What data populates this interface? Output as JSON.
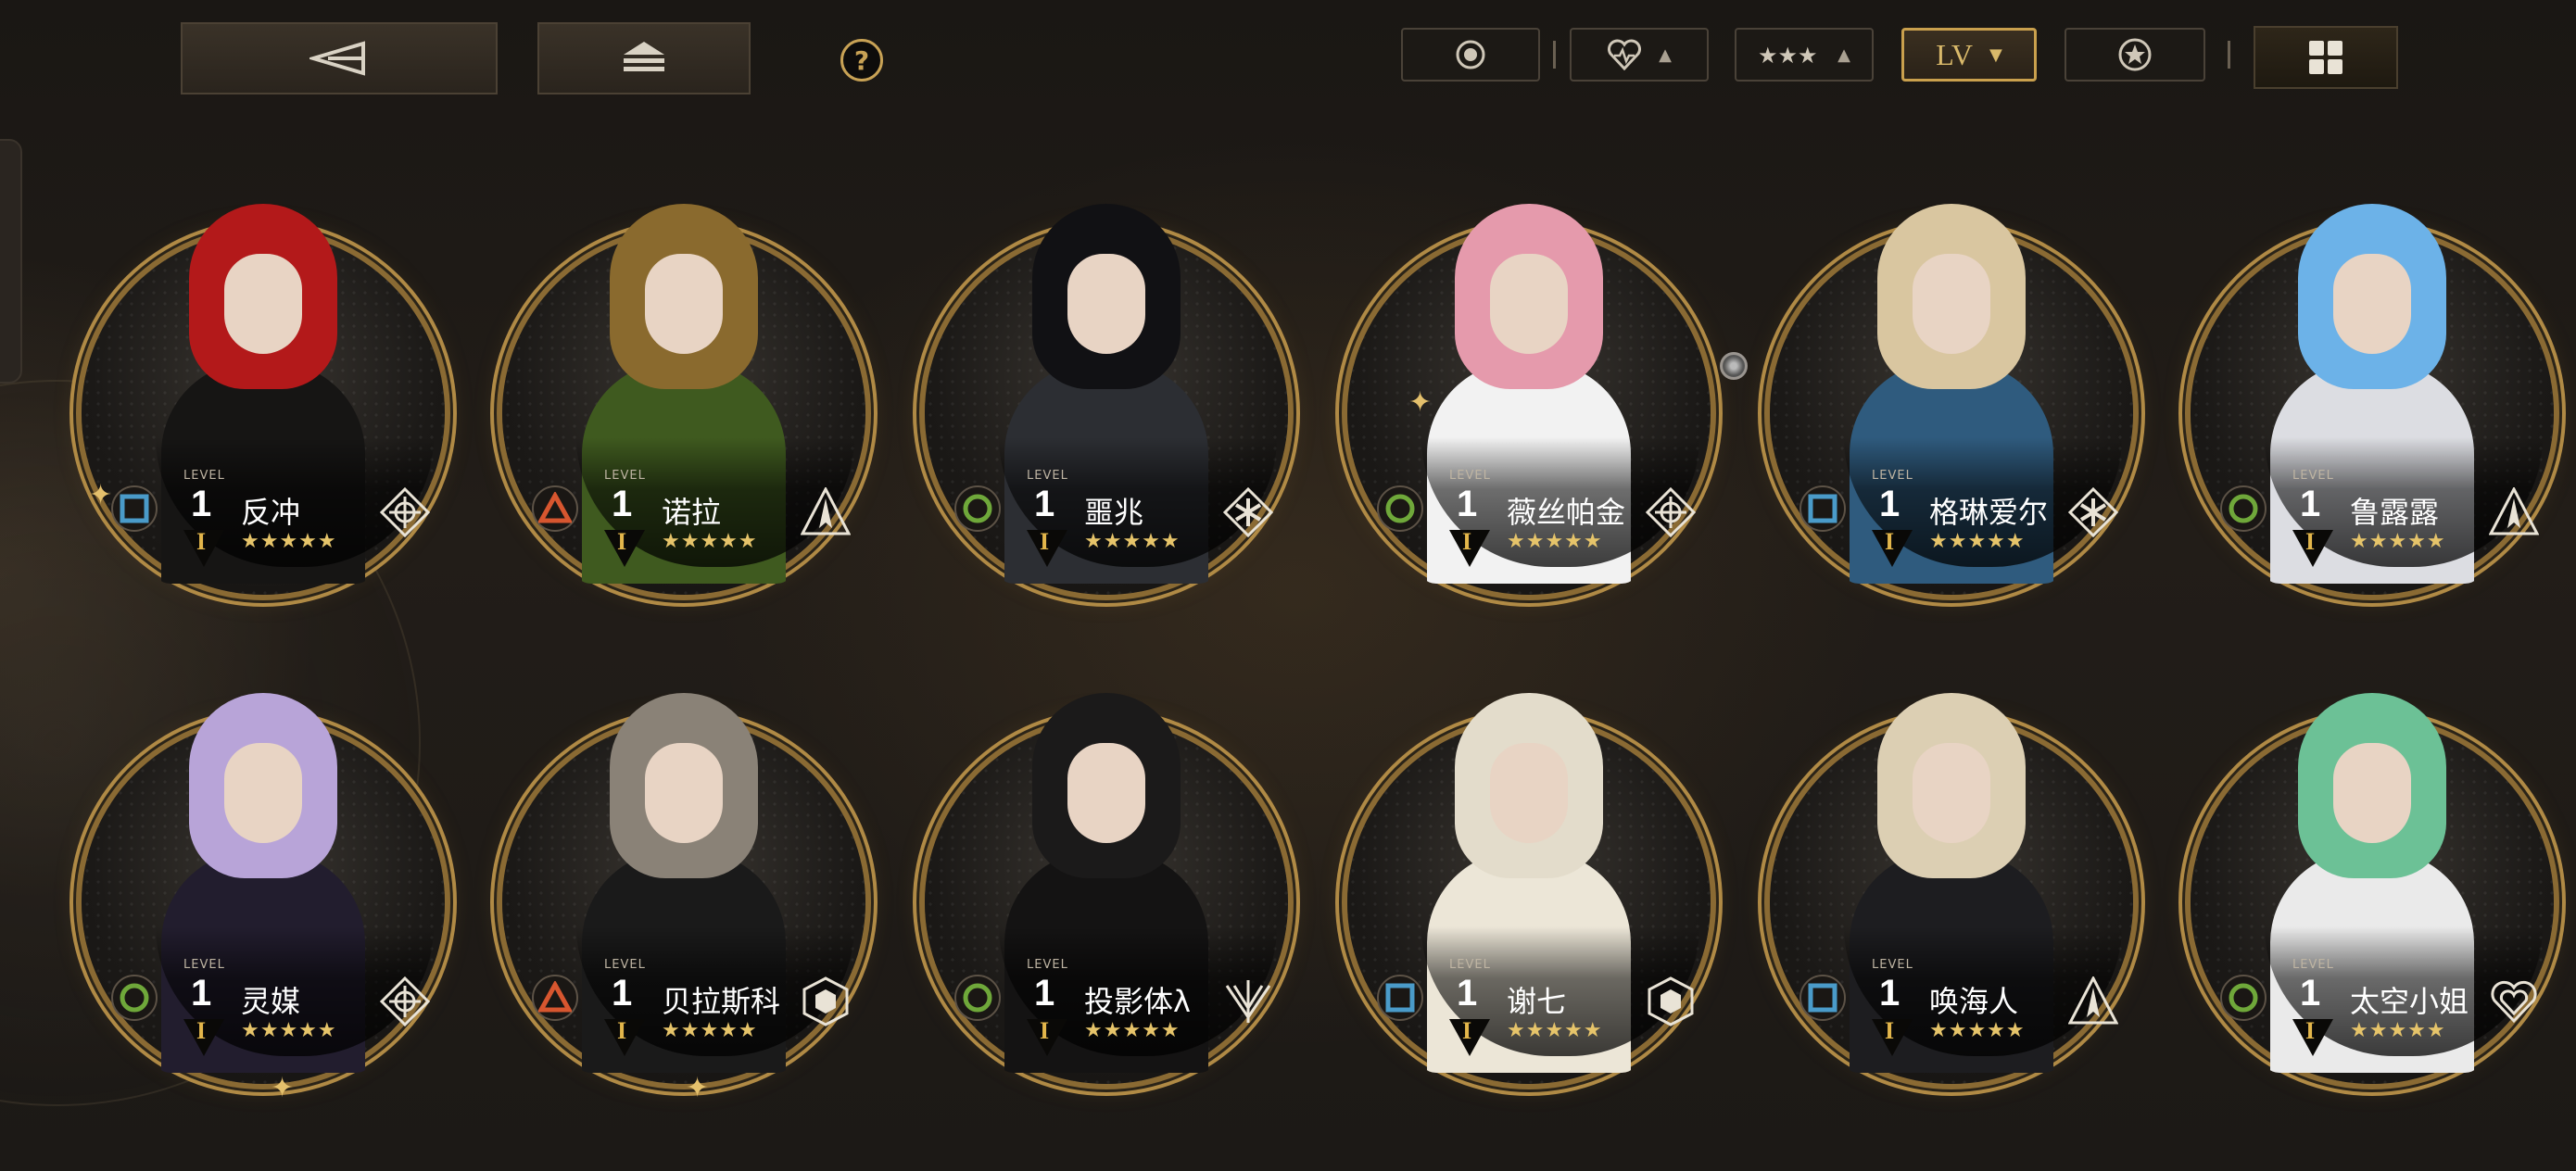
{
  "toolbar": {
    "back_icon": "back-arrow-icon",
    "home_icon": "home-stack-icon",
    "help_label": "?",
    "filters": [
      {
        "icon": "target-icon",
        "label": ""
      },
      {
        "icon": "heart-icon",
        "label": ""
      },
      {
        "icon": "stars-icon",
        "label": ""
      },
      {
        "icon": "level-sort",
        "label": "LV"
      },
      {
        "icon": "star-badge-icon",
        "label": ""
      }
    ],
    "view_icon": "grid-view-icon"
  },
  "characters": [
    {
      "name": "反冲",
      "level": "1",
      "level_tag": "LEVEL",
      "rank": "I",
      "stars": "★★★★★",
      "element": "square",
      "element_color": "#4a9bc9",
      "class_icon": "crosshair-class-icon",
      "hair": "#b3191a",
      "body": "#161514"
    },
    {
      "name": "诺拉",
      "level": "1",
      "level_tag": "LEVEL",
      "rank": "I",
      "stars": "★★★★★",
      "element": "triangle",
      "element_color": "#d7562f",
      "class_icon": "spike-class-icon",
      "hair": "#8a6a2e",
      "body": "#3f5a1f"
    },
    {
      "name": "噩兆",
      "level": "1",
      "level_tag": "LEVEL",
      "rank": "I",
      "stars": "★★★★★",
      "element": "circle",
      "element_color": "#6fa83a",
      "class_icon": "snowflake-class-icon",
      "hair": "#111114",
      "body": "#2c2e33"
    },
    {
      "name": "薇丝帕金",
      "level": "1",
      "level_tag": "LEVEL",
      "rank": "I",
      "stars": "★★★★★",
      "element": "circle",
      "element_color": "#6fa83a",
      "class_icon": "crosshair-class-icon",
      "hair": "#e59aac",
      "body": "#f2f2f2"
    },
    {
      "name": "格琳爱尔",
      "level": "1",
      "level_tag": "LEVEL",
      "rank": "I",
      "stars": "★★★★★",
      "element": "square",
      "element_color": "#4a9bc9",
      "class_icon": "snowflake-class-icon",
      "hair": "#d9c6a0",
      "body": "#2f5b7e"
    },
    {
      "name": "鲁露露",
      "level": "1",
      "level_tag": "LEVEL",
      "rank": "I",
      "stars": "★★★★★",
      "element": "circle",
      "element_color": "#6fa83a",
      "class_icon": "spike-class-icon",
      "hair": "#6cb2e8",
      "body": "#dcdde2"
    },
    {
      "name": "灵媒",
      "level": "1",
      "level_tag": "LEVEL",
      "rank": "I",
      "stars": "★★★★★",
      "element": "circle",
      "element_color": "#6fa83a",
      "class_icon": "crosshair-class-icon",
      "hair": "#b8a4d8",
      "body": "#221d2e"
    },
    {
      "name": "贝拉斯科",
      "level": "1",
      "level_tag": "LEVEL",
      "rank": "I",
      "stars": "★★★★★",
      "element": "triangle",
      "element_color": "#d7562f",
      "class_icon": "hex-class-icon",
      "hair": "#8a8277",
      "body": "#1a1a1a"
    },
    {
      "name": "投影体λ",
      "level": "1",
      "level_tag": "LEVEL",
      "rank": "I",
      "stars": "★★★★★",
      "element": "circle",
      "element_color": "#6fa83a",
      "class_icon": "wings-class-icon",
      "hair": "#1b1a1a",
      "body": "#141313"
    },
    {
      "name": "谢七",
      "level": "1",
      "level_tag": "LEVEL",
      "rank": "I",
      "stars": "★★★★★",
      "element": "square",
      "element_color": "#4a9bc9",
      "class_icon": "hex-class-icon",
      "hair": "#e3dccb",
      "body": "#ece6d7"
    },
    {
      "name": "唤海人",
      "level": "1",
      "level_tag": "LEVEL",
      "rank": "I",
      "stars": "★★★★★",
      "element": "square",
      "element_color": "#4a9bc9",
      "class_icon": "spike-class-icon",
      "hair": "#dccfb3",
      "body": "#1d1d20"
    },
    {
      "name": "太空小姐",
      "level": "1",
      "level_tag": "LEVEL",
      "rank": "I",
      "stars": "★★★★★",
      "element": "circle",
      "element_color": "#6fa83a",
      "class_icon": "heart-class-icon",
      "hair": "#6cc196",
      "body": "#eaeaea"
    }
  ]
}
